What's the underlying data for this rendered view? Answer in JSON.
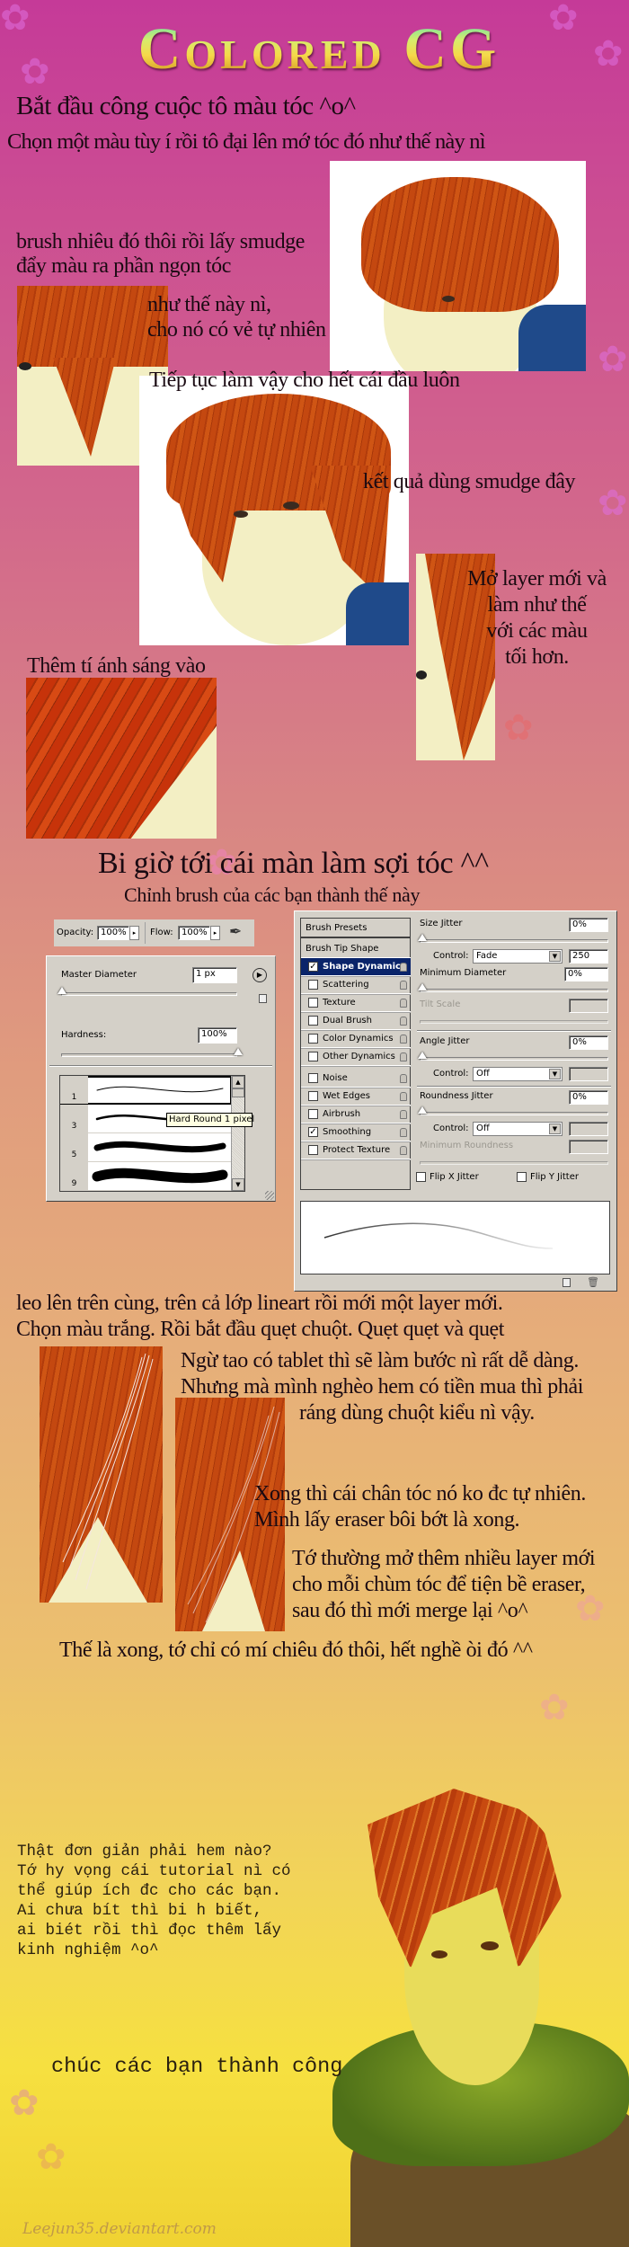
{
  "title": "Colored CG",
  "section1": {
    "heading": "Bắt đầu công cuộc tô màu tóc ^o^",
    "step1": "Chọn một màu tùy í rồi tô đại lên mớ tóc đó như thế này nì",
    "step2_lines": [
      "brush nhiêu đó thôi rồi lấy smudge",
      "đẩy màu ra phần ngọn tóc"
    ],
    "step3_lines": [
      "như thế này nì,",
      "cho nó có vẻ tự nhiên"
    ],
    "step4": "Tiếp tục làm vậy cho hết cái đầu luôn",
    "step5": "kết quả dùng smudge đây",
    "step6_lines": [
      "Mở layer mới và",
      "làm như thế",
      "với các màu",
      "tối hơn."
    ],
    "step7": "Thêm tí ánh sáng vào"
  },
  "section2": {
    "heading": "Bi giờ tới cái màn làm sợi tóc ^^",
    "subheading": "Chỉnh brush của các bạn thành thế này"
  },
  "options_bar": {
    "opacity_label": "Opacity:",
    "opacity_value": "100%",
    "flow_label": "Flow:",
    "flow_value": "100%",
    "airbrush_icon": "airbrush-icon"
  },
  "brush_picker": {
    "master_diameter_label": "Master Diameter",
    "master_diameter_value": "1 px",
    "hardness_label": "Hardness:",
    "hardness_value": "100%",
    "master_diameter_slider": 0.0,
    "hardness_slider": 1.0,
    "brushes": [
      {
        "size": "1",
        "selected": true
      },
      {
        "size": "3",
        "selected": false
      },
      {
        "size": "5",
        "selected": false
      },
      {
        "size": "9",
        "selected": false
      }
    ],
    "tooltip": "Hard Round 1 pixel"
  },
  "brushes_panel": {
    "presets_label": "Brush Presets",
    "tip_shape_label": "Brush Tip Shape",
    "options": [
      {
        "label": "Shape Dynamics",
        "checked": true,
        "active": true
      },
      {
        "label": "Scattering",
        "checked": false
      },
      {
        "label": "Texture",
        "checked": false
      },
      {
        "label": "Dual Brush",
        "checked": false
      },
      {
        "label": "Color Dynamics",
        "checked": false
      },
      {
        "label": "Other Dynamics",
        "checked": false
      },
      {
        "label": "Noise",
        "checked": false
      },
      {
        "label": "Wet Edges",
        "checked": false
      },
      {
        "label": "Airbrush",
        "checked": false
      },
      {
        "label": "Smoothing",
        "checked": true
      },
      {
        "label": "Protect Texture",
        "checked": false
      }
    ],
    "size_jitter_label": "Size Jitter",
    "size_jitter_value": "0%",
    "control_label": "Control:",
    "size_control": "Fade",
    "fade_steps": "250",
    "min_diameter_label": "Minimum Diameter",
    "min_diameter_value": "0%",
    "tilt_scale_label": "Tilt Scale",
    "angle_jitter_label": "Angle Jitter",
    "angle_jitter_value": "0%",
    "angle_control": "Off",
    "roundness_jitter_label": "Roundness Jitter",
    "roundness_jitter_value": "0%",
    "roundness_control": "Off",
    "min_roundness_label": "Minimum Roundness",
    "flip_x_label": "Flip X Jitter",
    "flip_y_label": "Flip Y Jitter"
  },
  "section3": {
    "step1_lines": [
      "leo lên trên cùng, trên cả lớp lineart rồi mới một layer mới.",
      "Chọn màu trắng. Rồi bắt đầu quẹt chuột. Quẹt quẹt và quẹt"
    ],
    "step2_lines": [
      "Ngừ tao có tablet thì sẽ làm bước nì rất dễ dàng.",
      "Nhưng mà mình nghèo hem có tiền mua thì phải",
      "ráng dùng chuột kiểu nì vậy."
    ],
    "step3_lines": [
      "Xong thì cái chân tóc nó ko đc tự nhiên.",
      "Mình lấy eraser bôi bớt là xong."
    ],
    "step4_lines": [
      "Tớ thường mở thêm nhiều layer mới",
      "cho mỗi chùm tóc để tiện bề eraser,",
      "sau đó thì mới merge lại ^o^"
    ],
    "ending": "Thế là xong, tớ chỉ có mí chiêu đó thôi, hết nghề òi đó ^^"
  },
  "outro": {
    "lines": [
      "Thật đơn giản phải hem nào?",
      "Tớ hy vọng cái tutorial nì có",
      "thể giúp ích đc cho các bạn.",
      "Ai chưa bít thì bi h biết,",
      "ai biét rồi thì đọc thêm lấy",
      "kinh nghiệm ^o^"
    ],
    "wish": "chúc các bạn thành công",
    "watermark": "Leejun35.deviantart.com"
  },
  "colors": {
    "hair": "#c44810",
    "skin": "#f3efc4",
    "panel": "#d4d0c8",
    "selection": "#0a246a"
  }
}
